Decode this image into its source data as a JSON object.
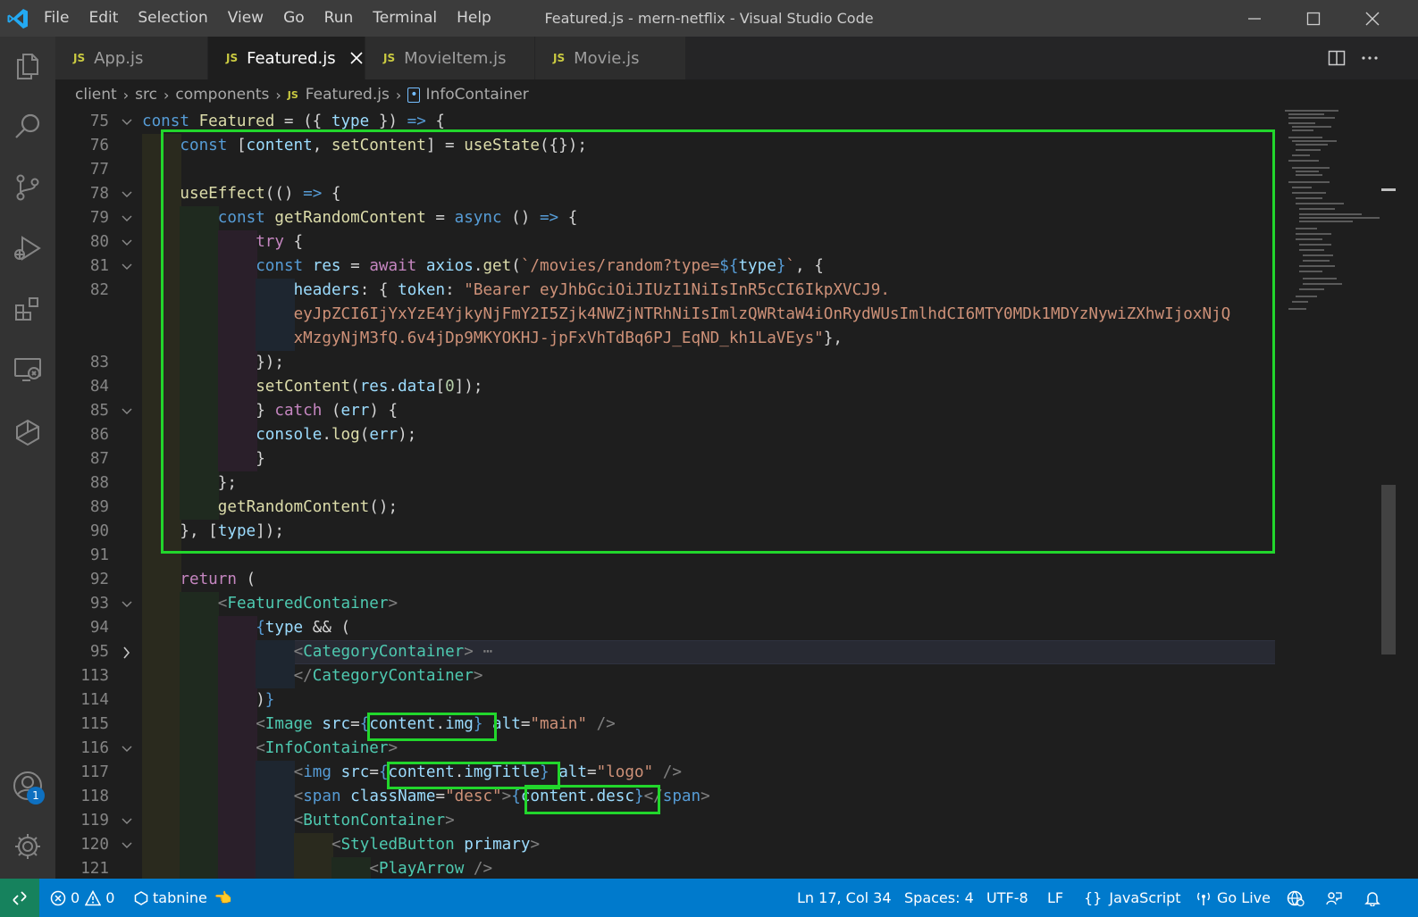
{
  "window": {
    "title": "Featured.js - mern-netflix - Visual Studio Code",
    "menu": [
      "File",
      "Edit",
      "Selection",
      "View",
      "Go",
      "Run",
      "Terminal",
      "Help"
    ]
  },
  "tabs": [
    {
      "lang": "JS",
      "label": "App.js"
    },
    {
      "lang": "JS",
      "label": "Featured.js"
    },
    {
      "lang": "JS",
      "label": "MovieItem.js"
    },
    {
      "lang": "JS",
      "label": "Movie.js"
    }
  ],
  "breadcrumb": {
    "items": [
      "client",
      "src",
      "components"
    ],
    "file_lang": "JS",
    "file": "Featured.js",
    "symbol": "InfoContainer"
  },
  "activity_bar": {
    "badge": "1",
    "icons": [
      "explorer-icon",
      "search-icon",
      "source-control-icon",
      "run-debug-icon",
      "extensions-icon",
      "remote-explorer-icon",
      "tabnine-icon",
      "account-icon",
      "settings-gear-icon"
    ]
  },
  "code": {
    "line_numbers": [
      "75",
      "76",
      "77",
      "78",
      "79",
      "80",
      "81",
      "82",
      "",
      "",
      "83",
      "84",
      "85",
      "86",
      "87",
      "88",
      "89",
      "90",
      "91",
      "92",
      "93",
      "94",
      "95",
      "113",
      "114",
      "115",
      "116",
      "117",
      "118",
      "119",
      "120",
      "121"
    ]
  },
  "status": {
    "errors": "0",
    "warnings": "0",
    "tabnine": "tabnine",
    "position": "Ln 17, Col 34",
    "spaces": "Spaces: 4",
    "encoding": "UTF-8",
    "eol": "LF",
    "language": "JavaScript",
    "live": "Go Live"
  },
  "colors": {
    "highlight_box": "#22d62c",
    "status_bar": "#007acc",
    "remote_indicator": "#16825d"
  }
}
